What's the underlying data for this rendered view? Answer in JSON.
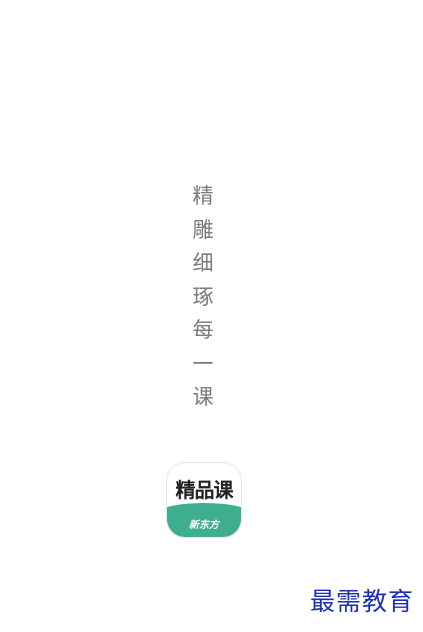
{
  "splash": {
    "slogan": [
      "精",
      "雕",
      "细",
      "琢",
      "每",
      "一",
      "课"
    ],
    "app_icon": {
      "title": "精品课",
      "subtitle": "新东方",
      "accent_color": "#3fae8f"
    }
  },
  "watermark": {
    "text": "最需教育",
    "color": "#1a2fb5"
  }
}
